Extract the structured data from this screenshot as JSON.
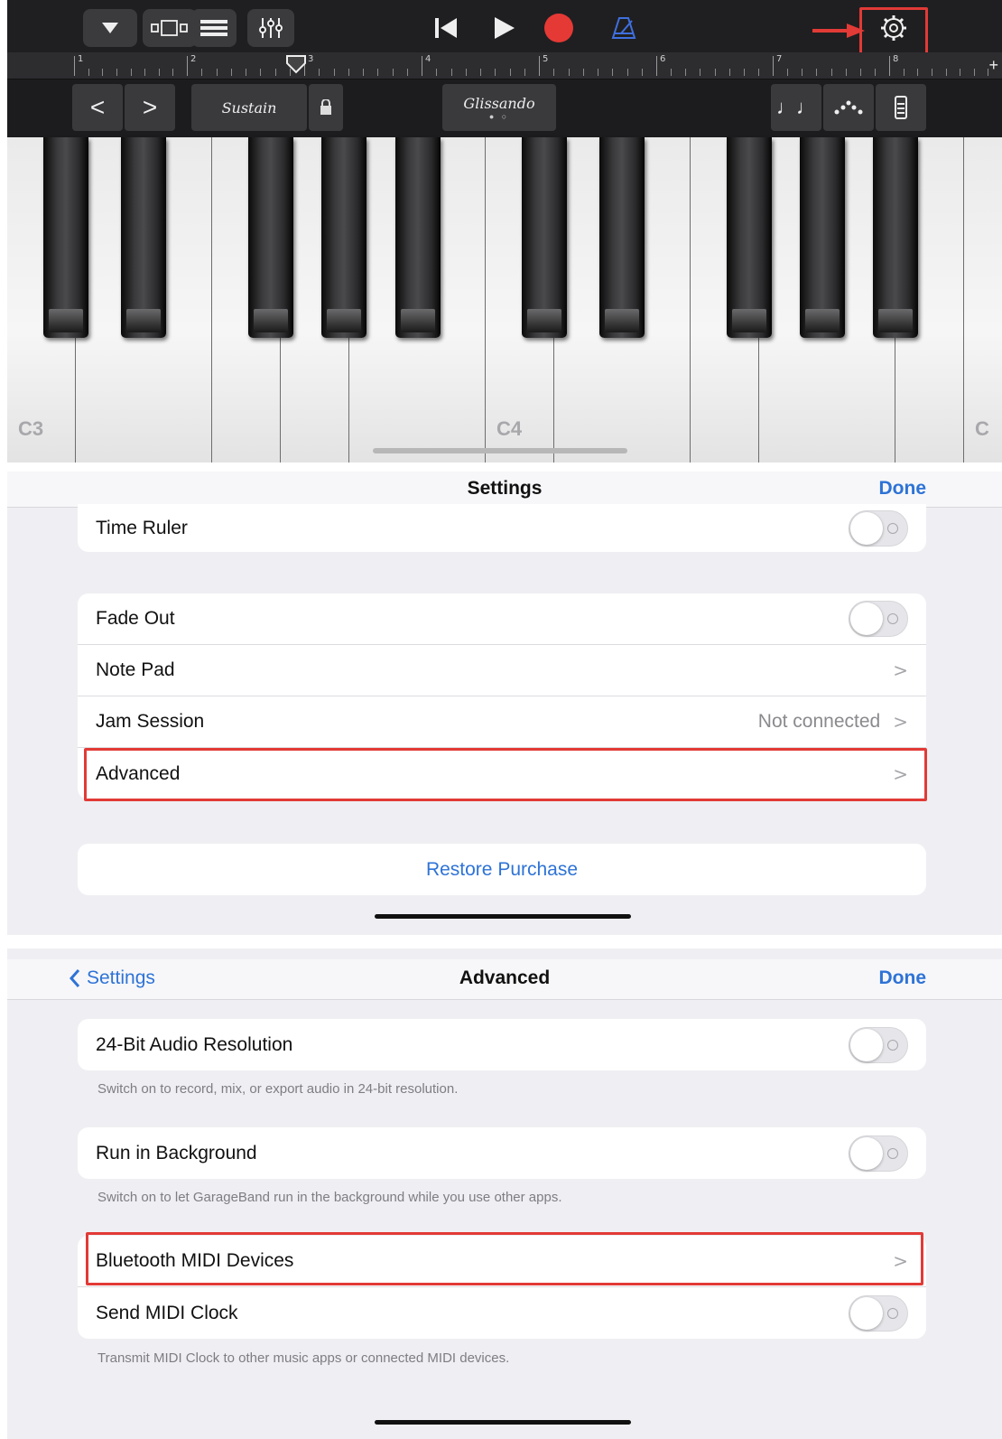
{
  "app": {
    "toolbar": {
      "browser_icon": "tracks-view-icon",
      "mixer_icon": "mixer-icon",
      "metronome_icon": "metronome-icon",
      "settings_icon": "gear-icon",
      "record_color": "#e53935",
      "accent_blue": "#2e73d6"
    },
    "ruler": {
      "bars": [
        "1",
        "2",
        "3",
        "4",
        "5",
        "6",
        "7",
        "8"
      ],
      "add_label": "+"
    },
    "controls": {
      "prev": "<",
      "next": ">",
      "sustain": "Sustain",
      "glissando": "Glissando"
    },
    "keyboard": {
      "labels": [
        "C3",
        "C4",
        "C"
      ]
    }
  },
  "settings": {
    "title": "Settings",
    "done": "Done",
    "rows": {
      "time_ruler": "Time Ruler",
      "fade_out": "Fade Out",
      "note_pad": "Note Pad",
      "jam_session": "Jam Session",
      "jam_session_value": "Not connected",
      "advanced": "Advanced",
      "restore": "Restore Purchase"
    },
    "toggles": {
      "time_ruler": false,
      "fade_out": false
    }
  },
  "advanced": {
    "back": "Settings",
    "title": "Advanced",
    "done": "Done",
    "rows": {
      "audio_24bit": "24-Bit Audio Resolution",
      "audio_24bit_note": "Switch on to record, mix, or export audio in 24-bit resolution.",
      "run_background": "Run in Background",
      "run_background_note": "Switch on to let GarageBand run in the background while you use other apps.",
      "bluetooth_midi": "Bluetooth MIDI Devices",
      "send_midi_clock": "Send MIDI Clock",
      "send_midi_clock_note": "Transmit MIDI Clock to other music apps or connected MIDI devices."
    },
    "toggles": {
      "audio_24bit": false,
      "run_background": false,
      "send_midi_clock": false
    }
  }
}
